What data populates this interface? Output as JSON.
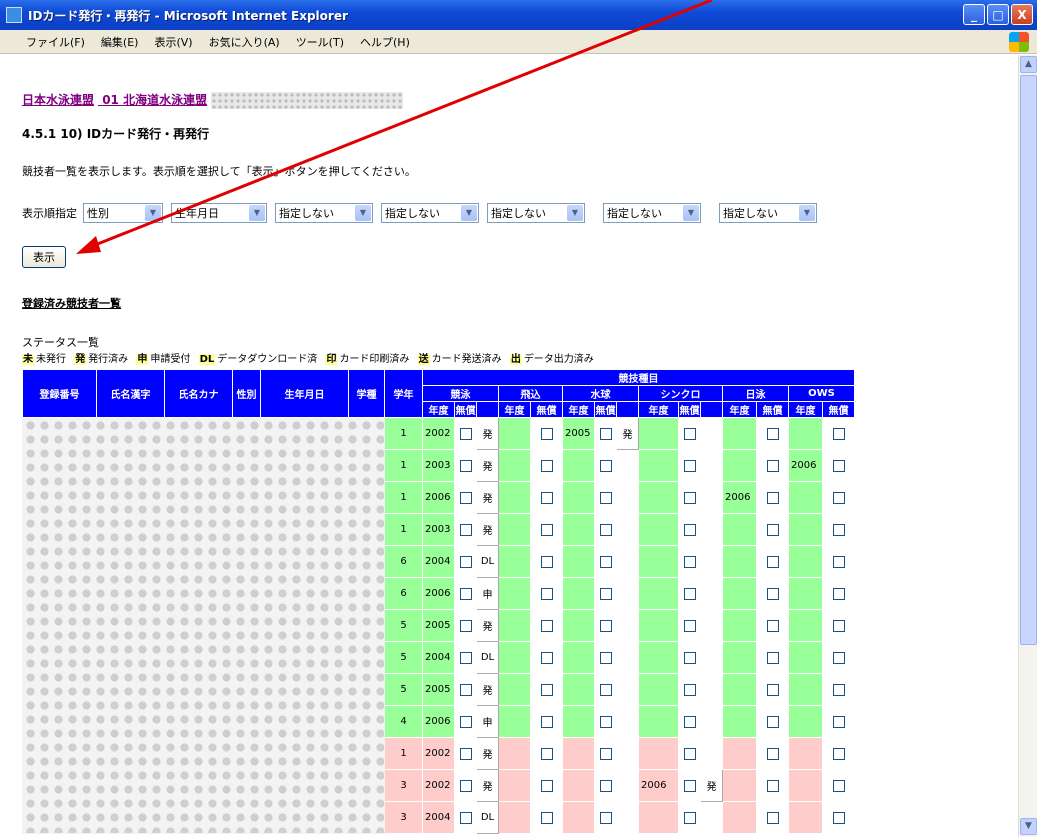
{
  "window": {
    "title": "IDカード発行・再発行 - Microsoft Internet Explorer",
    "buttons": [
      "_",
      "□",
      "X"
    ]
  },
  "menu": [
    "ファイル(F)",
    "編集(E)",
    "表示(V)",
    "お気に入り(A)",
    "ツール(T)",
    "ヘルプ(H)"
  ],
  "breadcrumb": {
    "link1": "日本水泳連盟",
    "link2": "01 北海道水泳連盟"
  },
  "page_title": "4.5.1 10) IDカード発行・再発行",
  "instruction": "競技者一覧を表示します。表示順を選択して「表示」ボタンを押してください。",
  "sort": {
    "label": "表示順指定",
    "selects": [
      "性別",
      "生年月日",
      "指定しない",
      "指定しない",
      "指定しない",
      "指定しない",
      "指定しない"
    ]
  },
  "show_button": "表示",
  "section_title": "登録済み競技者一覧",
  "status": {
    "title": "ステータス一覧",
    "items": [
      {
        "code": "未",
        "label": "未発行"
      },
      {
        "code": "発",
        "label": "発行済み"
      },
      {
        "code": "申",
        "label": "申請受付"
      },
      {
        "code": "DL",
        "label": "データダウンロード済"
      },
      {
        "code": "印",
        "label": "カード印刷済み"
      },
      {
        "code": "送",
        "label": "カード発送済み"
      },
      {
        "code": "出",
        "label": "データ出力済み"
      }
    ]
  },
  "table": {
    "headers": [
      "登録番号",
      "氏名漢字",
      "氏名カナ",
      "性別",
      "生年月日",
      "学種",
      "学年"
    ],
    "group_header": "競技種目",
    "events": [
      "競泳",
      "飛込",
      "水球",
      "シンクロ",
      "日泳",
      "OWS"
    ],
    "sub_year": "年度",
    "sub_free": "無償",
    "rows": [
      {
        "grade": "1",
        "swim_year": "2002",
        "swim_status": "発",
        "polo_year": "2005",
        "polo_status": "発",
        "sync_year": "",
        "sync_status": "",
        "nichi_year": "",
        "ows_year": "",
        "pink": false
      },
      {
        "grade": "1",
        "swim_year": "2003",
        "swim_status": "発",
        "polo_year": "",
        "polo_status": "",
        "sync_year": "",
        "sync_status": "",
        "nichi_year": "",
        "ows_year": "2006",
        "pink": false
      },
      {
        "grade": "1",
        "swim_year": "2006",
        "swim_status": "発",
        "polo_year": "",
        "polo_status": "",
        "sync_year": "",
        "sync_status": "",
        "nichi_year": "2006",
        "ows_year": "",
        "pink": false
      },
      {
        "grade": "1",
        "swim_year": "2003",
        "swim_status": "発",
        "polo_year": "",
        "polo_status": "",
        "sync_year": "",
        "sync_status": "",
        "nichi_year": "",
        "ows_year": "",
        "pink": false
      },
      {
        "grade": "6",
        "swim_year": "2004",
        "swim_status": "DL",
        "polo_year": "",
        "polo_status": "",
        "sync_year": "",
        "sync_status": "",
        "nichi_year": "",
        "ows_year": "",
        "pink": false
      },
      {
        "grade": "6",
        "swim_year": "2006",
        "swim_status": "申",
        "polo_year": "",
        "polo_status": "",
        "sync_year": "",
        "sync_status": "",
        "nichi_year": "",
        "ows_year": "",
        "pink": false
      },
      {
        "grade": "5",
        "swim_year": "2005",
        "swim_status": "発",
        "polo_year": "",
        "polo_status": "",
        "sync_year": "",
        "sync_status": "",
        "nichi_year": "",
        "ows_year": "",
        "pink": false
      },
      {
        "grade": "5",
        "swim_year": "2004",
        "swim_status": "DL",
        "polo_year": "",
        "polo_status": "",
        "sync_year": "",
        "sync_status": "",
        "nichi_year": "",
        "ows_year": "",
        "pink": false
      },
      {
        "grade": "5",
        "swim_year": "2005",
        "swim_status": "発",
        "polo_year": "",
        "polo_status": "",
        "sync_year": "",
        "sync_status": "",
        "nichi_year": "",
        "ows_year": "",
        "pink": false
      },
      {
        "grade": "4",
        "swim_year": "2006",
        "swim_status": "申",
        "polo_year": "",
        "polo_status": "",
        "sync_year": "",
        "sync_status": "",
        "nichi_year": "",
        "ows_year": "",
        "pink": false
      },
      {
        "grade": "1",
        "swim_year": "2002",
        "swim_status": "発",
        "polo_year": "",
        "polo_status": "",
        "sync_year": "",
        "sync_status": "",
        "nichi_year": "",
        "ows_year": "",
        "pink": true
      },
      {
        "grade": "3",
        "swim_year": "2002",
        "swim_status": "発",
        "polo_year": "",
        "polo_status": "",
        "sync_year": "2006",
        "sync_status": "発",
        "nichi_year": "",
        "ows_year": "",
        "pink": true
      },
      {
        "grade": "3",
        "swim_year": "2004",
        "swim_status": "DL",
        "polo_year": "",
        "polo_status": "",
        "sync_year": "",
        "sync_status": "",
        "nichi_year": "",
        "ows_year": "",
        "pink": true
      }
    ]
  },
  "colors": {
    "header_blue": "#0000ff",
    "green": "#99ff99",
    "pink": "#ffcccc",
    "status_highlight": "#ffff99",
    "link_purple": "#800080",
    "annotation_arrow": "#e00000"
  }
}
